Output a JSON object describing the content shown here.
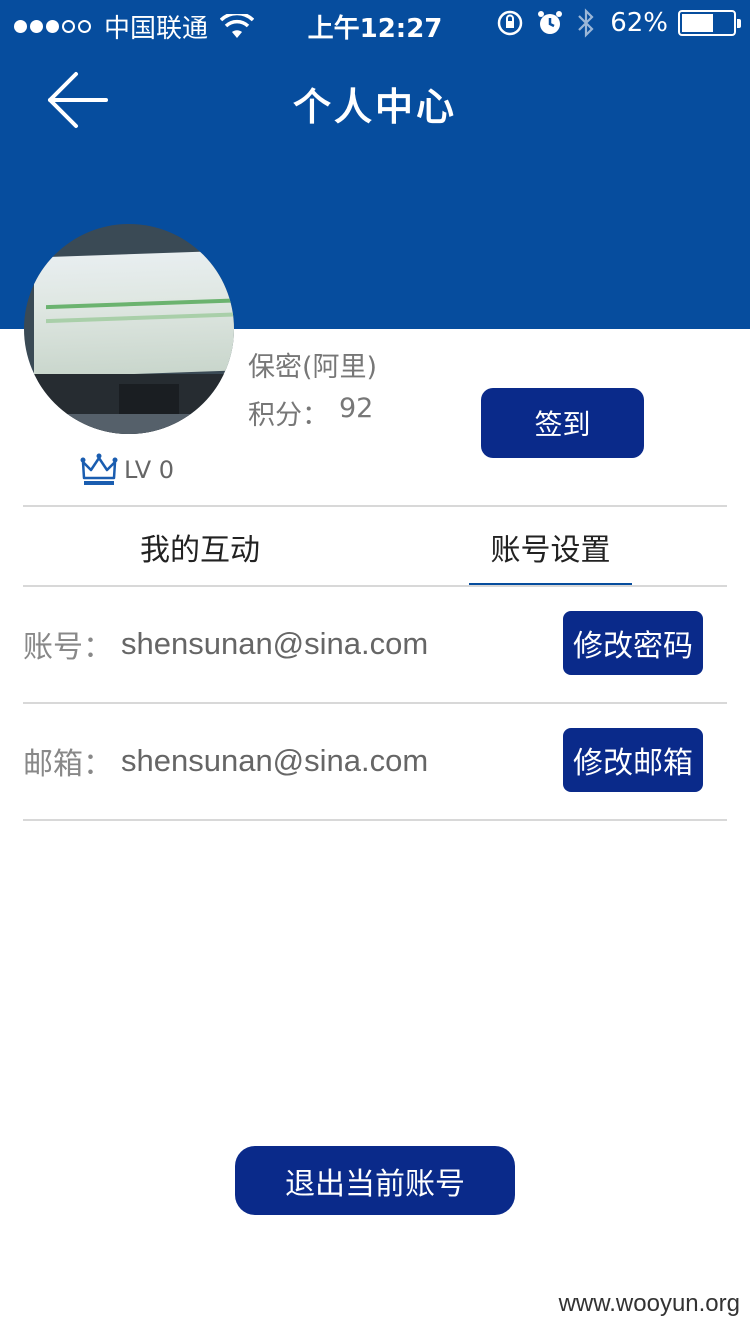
{
  "status_bar": {
    "carrier": "中国联通",
    "time": "上午12:27",
    "battery_percent": "62%",
    "battery_level": 0.62,
    "icons": [
      "signal-icon",
      "wifi-icon",
      "rotation-lock-icon",
      "alarm-icon",
      "bluetooth-icon",
      "battery-icon"
    ]
  },
  "nav": {
    "title": "个人中心",
    "back_icon": "back-arrow-icon"
  },
  "profile": {
    "nickname": "保密(阿里)",
    "points_label": "积分：",
    "points_value": "92",
    "checkin_label": "签到",
    "level_text": "LV 0",
    "level_icon": "crown-icon"
  },
  "tabs": [
    {
      "label": "我的互动",
      "active": false
    },
    {
      "label": "账号设置",
      "active": true
    }
  ],
  "account_rows": [
    {
      "label": "账号：",
      "value": "shensunan@sina.com",
      "button": "修改密码"
    },
    {
      "label": "邮箱：",
      "value": "shensunan@sina.com",
      "button": "修改邮箱"
    }
  ],
  "logout_label": "退出当前账号",
  "watermark": "www.wooyun.org",
  "colors": {
    "header": "#064d9e",
    "button": "#0a2a8a",
    "divider": "#d8d8d8"
  }
}
